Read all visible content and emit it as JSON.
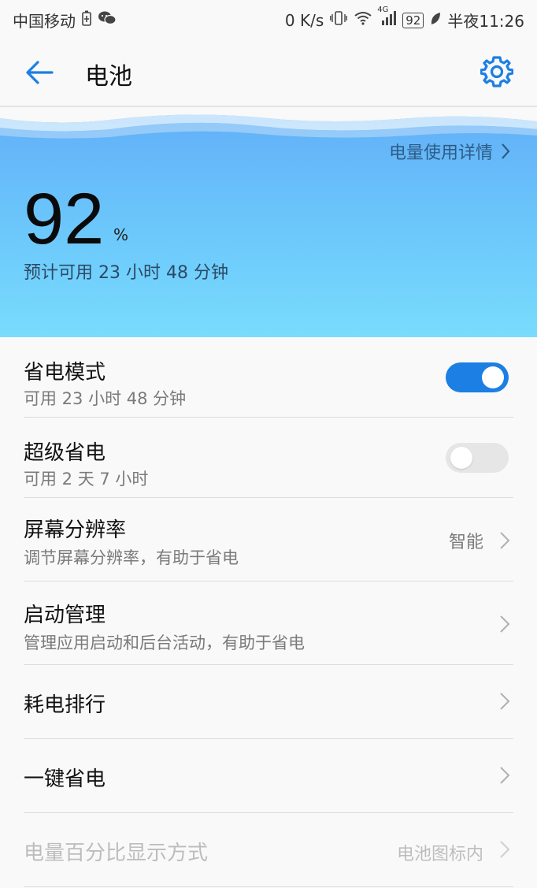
{
  "status_bar": {
    "carrier": "中国移动",
    "net_speed": "0 K/s",
    "network_type": "4G",
    "battery_level": "92",
    "time": "半夜11:26",
    "icons": [
      "battery-charging-icon",
      "wechat-icon",
      "vibrate-icon",
      "wifi-icon",
      "signal-icon",
      "leaf-icon"
    ]
  },
  "app_bar": {
    "title": "电池",
    "back_icon": "back-arrow-icon",
    "settings_icon": "gear-icon",
    "accent_color": "#1b7fe3"
  },
  "hero": {
    "detail_link": "电量使用详情",
    "battery_percent": "92",
    "percent_sign": "%",
    "estimate": "预计可用 23 小时 48 分钟"
  },
  "settings": {
    "power_saving": {
      "label": "省电模式",
      "sub": "可用 23 小时 48 分钟",
      "enabled": true
    },
    "ultra_saving": {
      "label": "超级省电",
      "sub": "可用 2 天 7 小时",
      "enabled": false
    },
    "resolution": {
      "label": "屏幕分辨率",
      "sub": "调节屏幕分辨率，有助于省电",
      "value": "智能"
    },
    "startup": {
      "label": "启动管理",
      "sub": "管理应用启动和后台活动，有助于省电"
    },
    "ranking": {
      "label": "耗电排行"
    },
    "one_tap": {
      "label": "一键省电"
    },
    "percent_display": {
      "label": "电量百分比显示方式",
      "value": "电池图标内",
      "disabled": true
    }
  }
}
